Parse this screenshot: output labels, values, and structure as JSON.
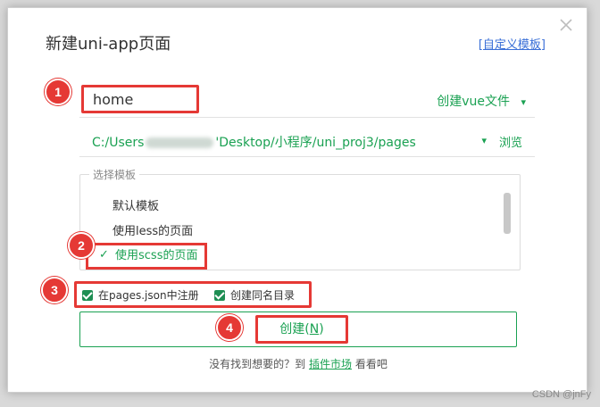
{
  "dialog": {
    "title": "新建uni-app页面",
    "custom_template_link": "[自定义模板]"
  },
  "name_input": {
    "value": "home"
  },
  "create_file_dropdown": {
    "label": "创建vue文件",
    "arrow": "▾"
  },
  "path": {
    "prefix": "C:/Users",
    "suffix": "'Desktop/小程序/uni_proj3/pages",
    "arrow": "▾",
    "browse_label": "浏览"
  },
  "templates": {
    "legend": "选择模板",
    "items": [
      {
        "label": "默认模板",
        "selected": false
      },
      {
        "label": "使用less的页面",
        "selected": false
      },
      {
        "label": "使用scss的页面",
        "selected": true
      }
    ],
    "check_mark": "✓"
  },
  "options": {
    "register_label": "在pages.json中注册",
    "register_checked": true,
    "same_dir_label": "创建同名目录",
    "same_dir_checked": true
  },
  "create_button": {
    "label": "创建(",
    "hotkey": "N",
    "close_paren": ")"
  },
  "footer": {
    "prefix": "没有找到想要的？到",
    "market_link": "插件市场",
    "suffix": "看看吧"
  },
  "badges": {
    "one": "1",
    "two": "2",
    "three": "3",
    "four": "4"
  },
  "watermark": "CSDN @jnFy",
  "colors": {
    "accent_green": "#1aa152",
    "annotation_red": "#e53935",
    "link_blue": "#3a6fd7"
  },
  "icons": {
    "close": "close-icon",
    "checkbox": "checkbox-checked-icon",
    "dropdown": "chevron-down-icon"
  }
}
